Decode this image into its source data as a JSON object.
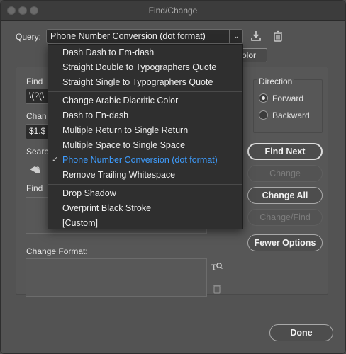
{
  "window": {
    "title": "Find/Change"
  },
  "query": {
    "label": "Query:",
    "selected": "Phone Number Conversion (dot format)",
    "save_icon": "download-tray-icon",
    "delete_icon": "trash-icon"
  },
  "tab_peek": "olor",
  "find": {
    "label": "Find",
    "value": "\\(?(\\",
    "format_label": "Find"
  },
  "change": {
    "label": "Chan",
    "value": "$1.$",
    "format_label": "Change Format:"
  },
  "search": {
    "label": "Searc"
  },
  "direction": {
    "label": "Direction",
    "options": [
      {
        "label": "Forward",
        "selected": true
      },
      {
        "label": "Backward",
        "selected": false
      }
    ]
  },
  "buttons": {
    "find_next": "Find Next",
    "change": "Change",
    "change_all": "Change All",
    "change_find": "Change/Find",
    "fewer_options": "Fewer Options",
    "done": "Done"
  },
  "menu": {
    "groups": [
      [
        "Dash Dash to Em-dash",
        "Straight Double to Typographers Quote",
        "Straight Single to Typographers Quote"
      ],
      [
        "Change Arabic Diacritic Color",
        "Dash to En-dash",
        "Multiple Return to Single Return",
        "Multiple Space to Single Space",
        "Phone Number Conversion (dot format)",
        "Remove Trailing Whitespace"
      ],
      [
        "Drop Shadow",
        "Overprint Black Stroke",
        "[Custom]"
      ]
    ],
    "selected_label": "Phone Number Conversion (dot format)",
    "checkmark": "✓"
  },
  "colors": {
    "selected_item": "#3e9dff"
  }
}
